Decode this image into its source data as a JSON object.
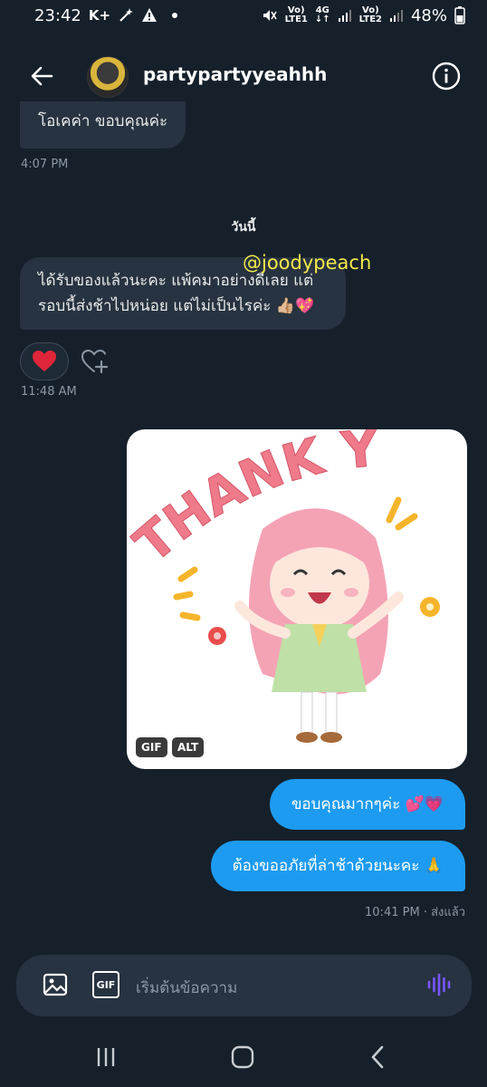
{
  "status_bar": {
    "time": "23:42",
    "carrier_icons": "K+",
    "lte1_top": "Vo)",
    "lte1_bottom": "LTE1",
    "net_top": "4G",
    "net_bottom": "↓↑",
    "lte2_top": "Vo)",
    "lte2_bottom": "LTE2",
    "battery": "48%"
  },
  "header": {
    "username": "partypartyyeahhh"
  },
  "messages": {
    "received_1": "โอเคค่า ขอบคุณค่ะ",
    "received_1_time": "4:07 PM",
    "day_separator": "วันนี้",
    "watermark": "@joodypeach",
    "received_2_line1": "ได้รับของแล้วนะคะ แพ้คมาอย่างดีเลย แต่",
    "received_2_line2": "รอบนี้ส่งช้าไปหน่อย แต่ไม่เป็นไรค่ะ 👍🏼💖",
    "received_2_time": "11:48 AM",
    "reaction": "❤️",
    "gif_text": "THANK YOU",
    "gif_badge": "GIF",
    "alt_badge": "ALT",
    "sent_1": "ขอบคุณมากๆค่ะ 💕💗",
    "sent_2": "ต้องขออภัยที่ล่าช้าด้วยนะคะ 🙏",
    "sent_time": "10:41 PM · ส่งแล้ว"
  },
  "composer": {
    "placeholder": "เริ่มต้นข้อความ",
    "gif_button": "GIF"
  },
  "colors": {
    "background": "#15202b",
    "received_bubble": "#273340",
    "sent_bubble": "#1d9bf0",
    "voice_icon": "#7856ff"
  },
  "icons": {
    "back": "arrow-left-icon",
    "info": "info-icon",
    "add_reaction": "heart-plus-icon",
    "image": "image-icon",
    "voice": "voice-wave-icon"
  }
}
